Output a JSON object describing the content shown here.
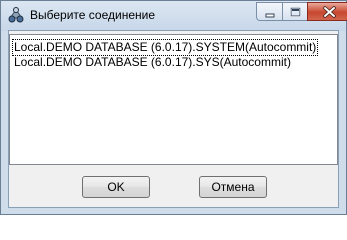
{
  "window": {
    "title": "Выберите соединение",
    "icon": "db-connection-icon",
    "caption_buttons": [
      "minimize-icon",
      "maximize-icon",
      "close-icon"
    ]
  },
  "connections": {
    "items": [
      {
        "label": "Local.DEMO DATABASE (6.0.17).SYSTEM(Autocommit)",
        "selected": true
      },
      {
        "label": "Local.DEMO DATABASE (6.0.17).SYS(Autocommit)",
        "selected": false
      }
    ]
  },
  "buttons": {
    "ok_label": "OK",
    "cancel_label": "Отмена"
  },
  "colors": {
    "titlebar": "#c7d7e9",
    "close_button": "#c7472f",
    "dialog_background": "#f0f0f0"
  }
}
